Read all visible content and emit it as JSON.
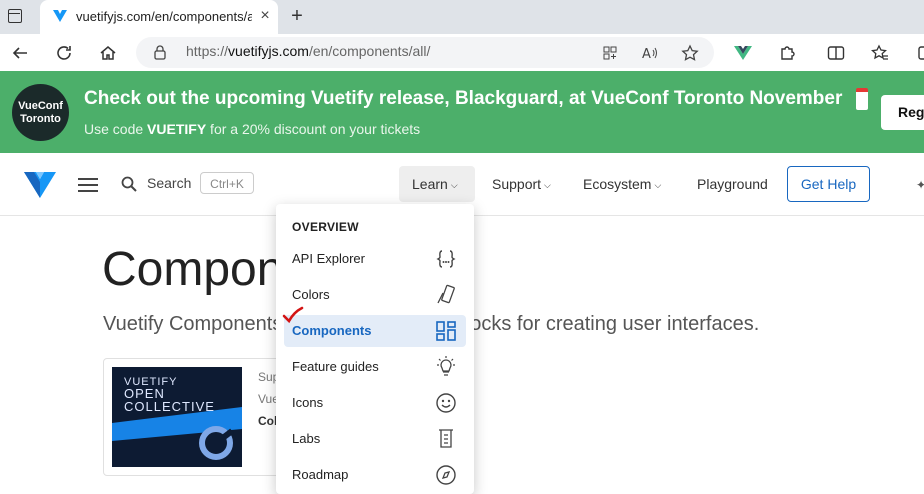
{
  "browser": {
    "tab_title": "vuetifyjs.com/en/components/all/",
    "tab_close": "×",
    "new_tab": "+",
    "url_prefix": "https://",
    "url_host": "vuetifyjs.com",
    "url_path": "/en/components/all/",
    "icons": [
      "back-icon",
      "refresh-icon",
      "home-icon",
      "lock-icon",
      "apps-icon",
      "read-aloud-icon",
      "favorite-star-icon",
      "vue-devtools-icon",
      "extensions-icon",
      "split-screen-icon",
      "favorites-icon",
      "collections-icon"
    ]
  },
  "banner": {
    "badge_line1": "VueConf",
    "badge_line2": "Toronto",
    "title_a": "Check out the upcoming Vuetify release, ",
    "title_b": "Blackguard",
    "title_c": ", at VueConf Toronto November",
    "sub_a": "Use code ",
    "sub_code": "VUETIFY",
    "sub_b": " for a 20% discount on your tickets",
    "button": "Reg",
    "color": "#4caf6a"
  },
  "nav": {
    "search_label": "Search",
    "search_shortcut": "Ctrl+K",
    "learn": "Learn",
    "support": "Support",
    "ecosystem": "Ecosystem",
    "playground": "Playground",
    "get_help": "Get Help",
    "accent": "#1867c0"
  },
  "page": {
    "title": "Compon",
    "lead_left": "Vuetify Components",
    "lead_right": "g blocks for creating user interfaces.",
    "card_line1": "Sup",
    "card_line2": "Vue",
    "card_line3": "Col",
    "sponsor_line1": "VUETIFY",
    "sponsor_line2": "OPEN",
    "sponsor_line3": "COLLECTIVE"
  },
  "menu": {
    "heading": "OVERVIEW",
    "items": [
      {
        "label": "API Explorer",
        "icon": "code-braces-icon"
      },
      {
        "label": "Colors",
        "icon": "palette-swatch-icon"
      },
      {
        "label": "Components",
        "icon": "view-dashboard-icon",
        "active": true
      },
      {
        "label": "Feature guides",
        "icon": "lightbulb-icon"
      },
      {
        "label": "Icons",
        "icon": "emoticon-icon"
      },
      {
        "label": "Labs",
        "icon": "beaker-icon"
      },
      {
        "label": "Roadmap",
        "icon": "compass-icon"
      }
    ]
  }
}
